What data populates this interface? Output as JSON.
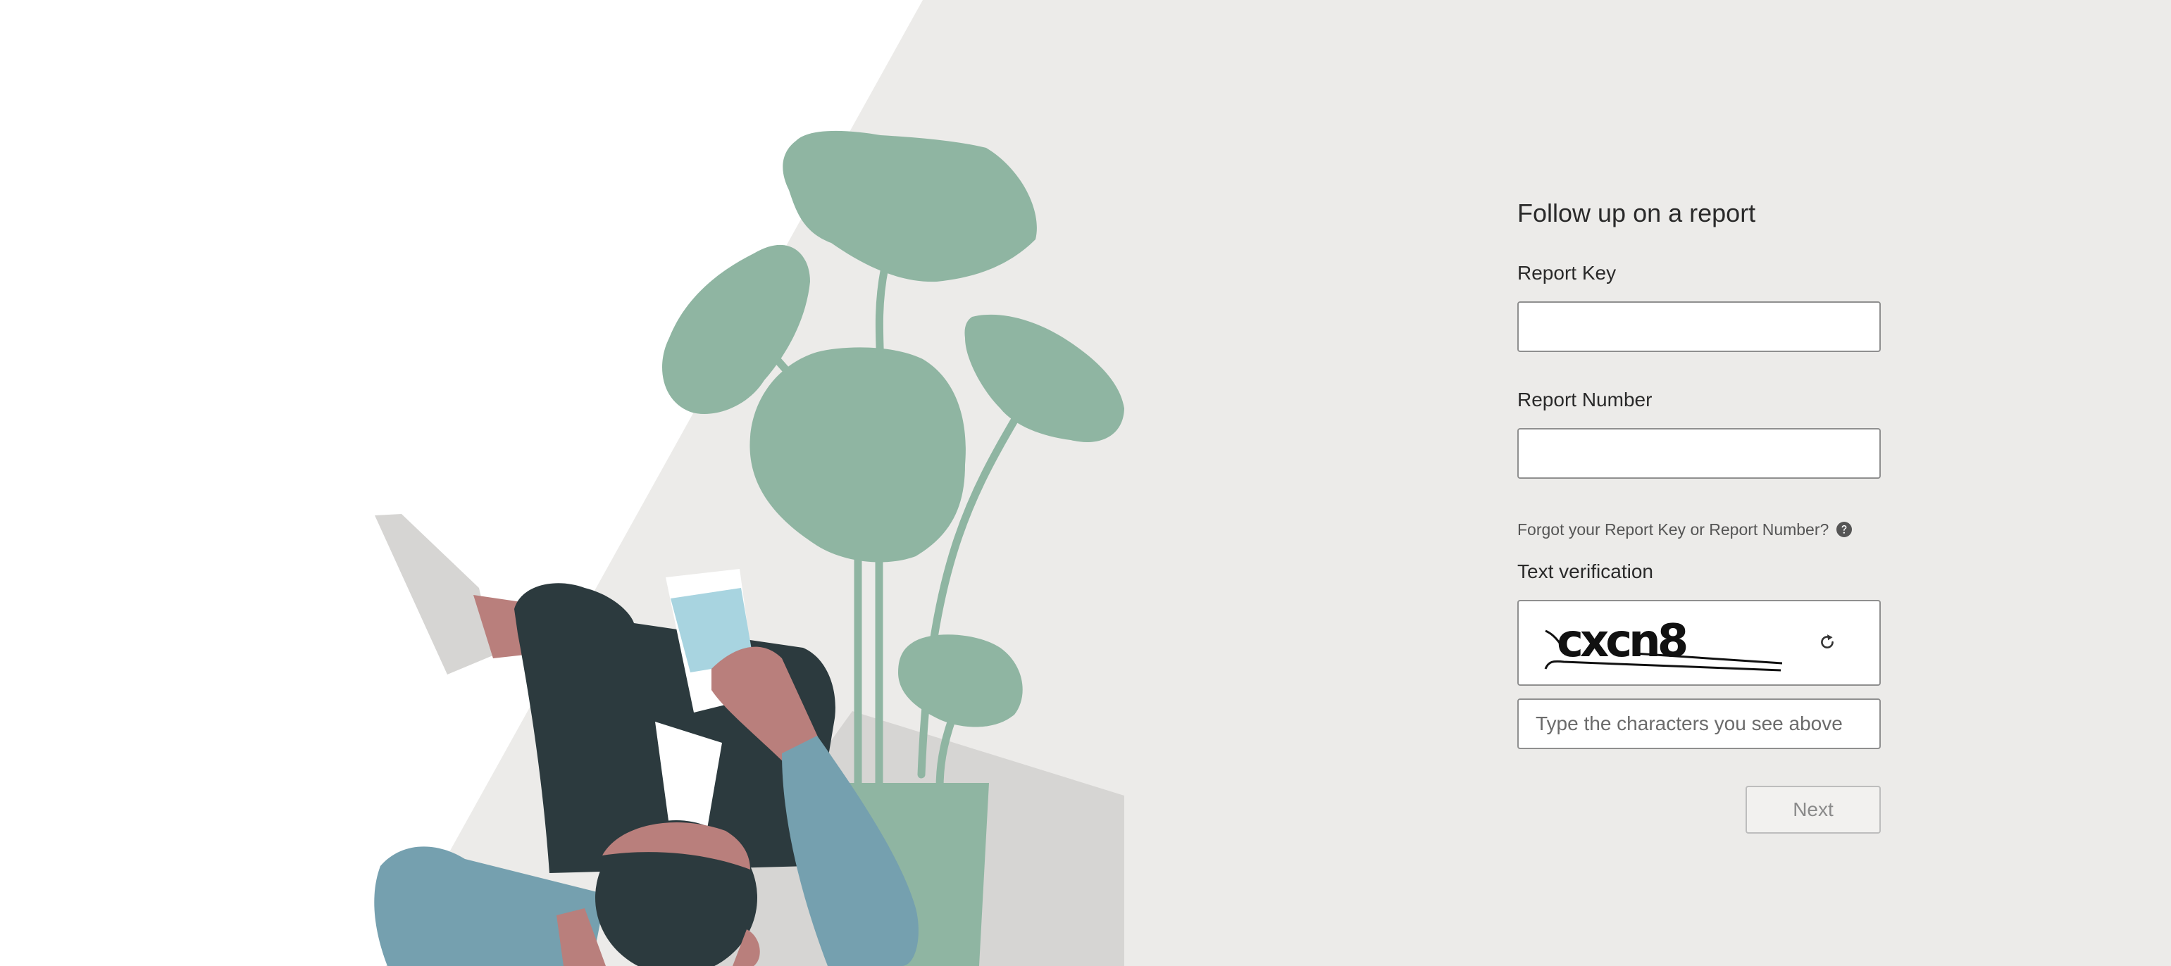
{
  "form": {
    "title": "Follow up on a report",
    "report_key": {
      "label": "Report Key",
      "value": "",
      "placeholder": ""
    },
    "report_number": {
      "label": "Report Number",
      "value": "",
      "placeholder": ""
    },
    "forgot_link": "Forgot your Report Key or Report Number?",
    "text_verification": {
      "label": "Text verification",
      "captcha_text": "cxcn8",
      "input_placeholder": "Type the characters you see above",
      "input_value": ""
    },
    "next_label": "Next"
  },
  "icons": {
    "help": "question-circle-icon",
    "refresh": "refresh-icon"
  },
  "colors": {
    "background": "#ecebe9",
    "illustration_green": "#8fb5a2",
    "illustration_dark": "#2c3a3e",
    "illustration_pink": "#b97f7c",
    "illustration_blue": "#75a0af",
    "phone_blue": "#a8d4e0",
    "input_border": "#8f8f8f",
    "button_disabled_text": "#8a8a8a"
  }
}
